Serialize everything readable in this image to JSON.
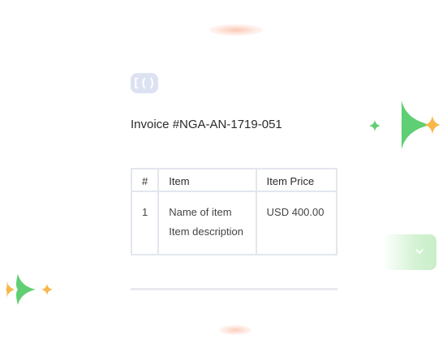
{
  "brand": {
    "logo_text": "[()",
    "logo_icon": "brand-logo-icon"
  },
  "invoice": {
    "title": "Invoice #NGA-AN-1719-051",
    "table": {
      "headers": [
        "#",
        "Item",
        "Item Price"
      ],
      "rows": [
        {
          "number": "1",
          "item_name": "Name of item",
          "item_description": "Item description",
          "price": "USD 400.00"
        }
      ]
    }
  },
  "decorations": {
    "sparkle_colors": {
      "green": "#5fcf73",
      "orange": "#f7b749"
    },
    "dropdown_icon": "chevron-down-icon"
  }
}
